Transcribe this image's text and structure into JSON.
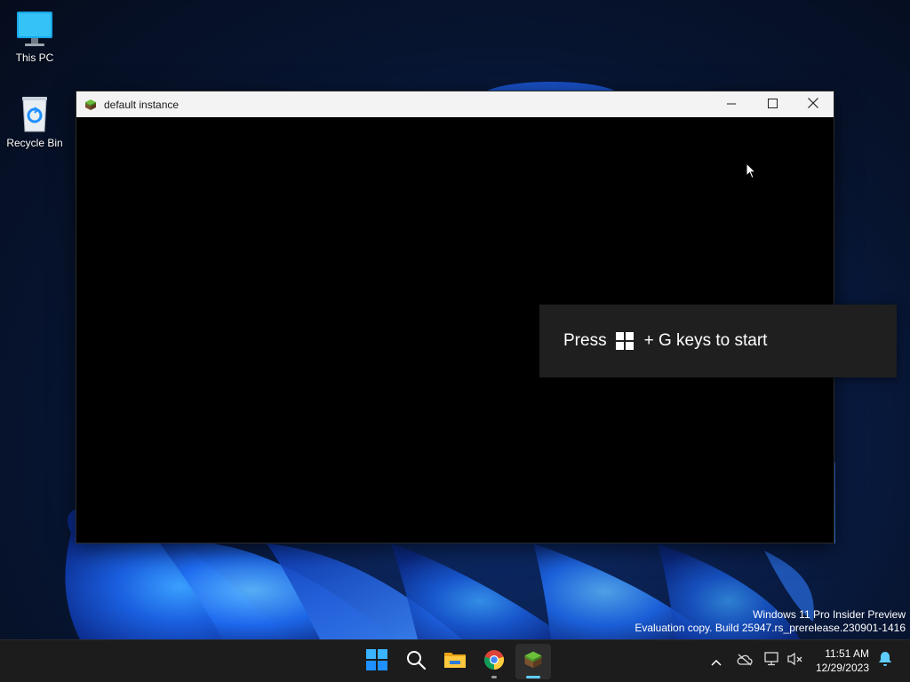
{
  "desktop": {
    "icons": [
      {
        "label": "This PC",
        "icon": "monitor-icon"
      },
      {
        "label": "Recycle Bin",
        "icon": "recycle-bin-icon"
      }
    ],
    "watermark": {
      "line1": "Windows 11 Pro Insider Preview",
      "line2": "Evaluation copy. Build 25947.rs_prerelease.230901-1416"
    }
  },
  "window": {
    "title": "default instance",
    "app_icon": "minecraft-block-icon",
    "controls": [
      "minimize-icon",
      "maximize-icon",
      "close-icon"
    ]
  },
  "gamebar_toast": {
    "before": "Press",
    "key_icon": "windows-logo-icon",
    "after": "+ G keys to start"
  },
  "taskbar": {
    "buttons": [
      {
        "name": "start",
        "icon": "windows-logo-icon",
        "running": false
      },
      {
        "name": "search",
        "icon": "search-icon",
        "running": false
      },
      {
        "name": "file-explorer",
        "icon": "folder-icon",
        "running": false
      },
      {
        "name": "chrome",
        "icon": "chrome-icon",
        "running": true
      },
      {
        "name": "minecraft",
        "icon": "minecraft-block-icon",
        "running": true,
        "active": true
      }
    ],
    "tray": [
      "chevron-up-icon",
      "onedrive-offline-icon",
      "network-icon",
      "volume-muted-icon"
    ],
    "clock": {
      "time": "11:51 AM",
      "date": "12/29/2023"
    },
    "notification_icon": "bell-icon"
  },
  "colors": {
    "accent": "#60cdff",
    "taskbar_bg": "#1c1c1c",
    "titlebar_bg": "#f3f3f3",
    "toast_bg": "#1f1f1f"
  }
}
